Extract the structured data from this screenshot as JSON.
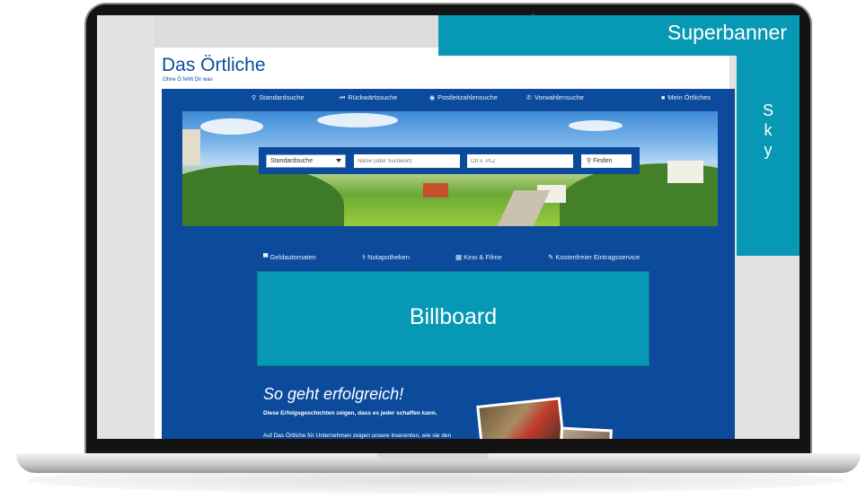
{
  "ad_slots": {
    "superbanner": "Superbanner",
    "sky": [
      "S",
      "k",
      "y"
    ],
    "billboard": "Billboard"
  },
  "site": {
    "logo": "Das Örtliche",
    "slogan": "Ohne Ö fehlt Dir was"
  },
  "nav": {
    "standardsuche": "Standardsuche",
    "rueckwaertssuche": "Rückwärtssuche",
    "postleitzahlensuche": "Postleitzahlensuche",
    "vorwahlensuche": "Vorwahlensuche",
    "mein_oertliches": "Mein Örtliches"
  },
  "search": {
    "type_selected": "Standardsuche",
    "name_placeholder": "Name (oder Suchwort)",
    "location_placeholder": "Ort o. PLZ",
    "button": "Finden"
  },
  "quicklinks": {
    "geldautomaten": "Geldautomaten",
    "notapotheken": "Notapotheken",
    "kino": "Kino & Filme",
    "eintrag": "Kostenfreier Eintragsservice"
  },
  "promo": {
    "title": "So geht erfolgreich!",
    "subtitle": "Diese Erfolgsgeschichten zeigen, dass es jeder schaffen kann.",
    "body": "Auf Das Örtliche für Unternehmen zeigen unsere Inserenten, wie sie den digitalen Auftritt ihres Unternehmens gemeistert"
  },
  "colors": {
    "ad_teal": "#0698b4",
    "site_blue": "#0c4b9c",
    "logo_blue": "#0a4d9c"
  }
}
